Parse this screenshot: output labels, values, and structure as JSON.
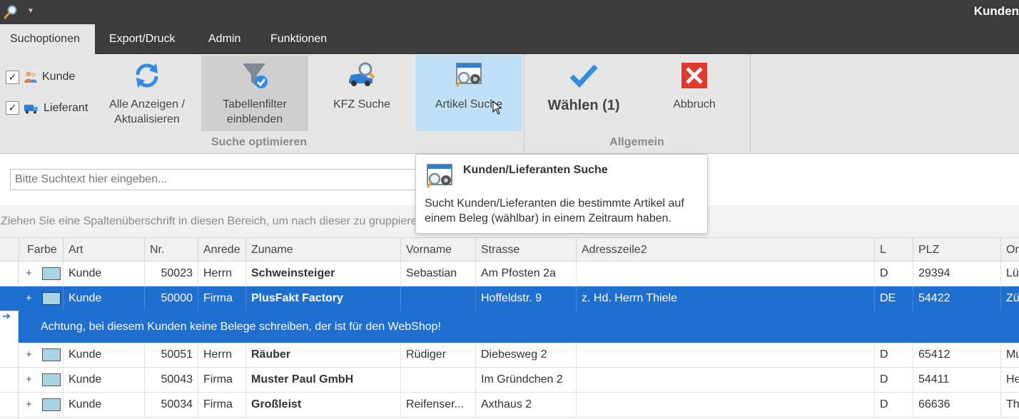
{
  "window": {
    "title": "Kunden",
    "app_icon": "magnifier-icon",
    "qat_icon": "chevron-down-icon"
  },
  "tabs": [
    {
      "label": "Suchoptionen",
      "active": true
    },
    {
      "label": "Export/Druck",
      "active": false
    },
    {
      "label": "Admin",
      "active": false
    },
    {
      "label": "Funktionen",
      "active": false
    }
  ],
  "ribbon": {
    "filters": [
      {
        "label": "Kunde",
        "checked": true,
        "icon": "customer-icon"
      },
      {
        "label": "Lieferant",
        "checked": true,
        "icon": "truck-icon"
      }
    ],
    "buttons": {
      "refresh": {
        "line1": "Alle Anzeigen /",
        "line2": "Aktualisieren",
        "icon": "refresh-icon"
      },
      "filter": {
        "line1": "Tabellenfilter",
        "line2": "einblenden",
        "icon": "funnel-check-icon"
      },
      "kfz": {
        "label": "KFZ Suche",
        "icon": "car-search-icon"
      },
      "artikel": {
        "label": "Artikel Suche",
        "icon": "article-search-icon"
      },
      "waehlen": {
        "label": "Wählen (1)",
        "icon": "checkmark-icon"
      },
      "abbruch": {
        "label": "Abbruch",
        "icon": "cancel-icon"
      }
    },
    "groups": {
      "search": "Suche optimieren",
      "general": "Allgemein"
    }
  },
  "search": {
    "placeholder": "Bitte Suchtext hier eingeben..."
  },
  "group_hint": "Ziehen Sie eine Spaltenüberschrift in diesen Bereich, um nach dieser zu gruppieren",
  "tooltip": {
    "title": "Kunden/Lieferanten Suche",
    "body": "Sucht Kunden/Lieferanten die bestimmte Artikel auf einem Beleg (wählbar) in einem Zeitraum haben."
  },
  "grid": {
    "columns": [
      "Farbe",
      "Art",
      "Nr.",
      "Anrede",
      "Zuname",
      "Vorname",
      "Strasse",
      "Adresszeile2",
      "L",
      "PLZ",
      "Ort"
    ],
    "rows": [
      {
        "art": "Kunde",
        "nr": "50023",
        "anrede": "Herrn",
        "zuname": "Schweinsteiger",
        "vorname": "Sebastian",
        "strasse": "Am Pfosten 2a",
        "adresszeile2": "",
        "land": "D",
        "plz": "29394",
        "ort": "Lüd",
        "selected": false
      },
      {
        "art": "Kunde",
        "nr": "50000",
        "anrede": "Firma",
        "zuname": "PlusFakt Factory",
        "vorname": "",
        "strasse": "Hoffeldstr. 9",
        "adresszeile2": "z. Hd. Herrn Thiele",
        "land": "DE",
        "plz": "54422",
        "ort": "Zü",
        "selected": true
      },
      {
        "art": "Kunde",
        "nr": "50051",
        "anrede": "Herrn",
        "zuname": "Räuber",
        "vorname": "Rüdiger",
        "strasse": "Diebesweg 2",
        "adresszeile2": "",
        "land": "D",
        "plz": "65412",
        "ort": "Mu",
        "selected": false
      },
      {
        "art": "Kunde",
        "nr": "50043",
        "anrede": "Firma",
        "zuname": "Muster Paul GmbH",
        "vorname": "",
        "strasse": "Im Gründchen 2",
        "adresszeile2": "",
        "land": "D",
        "plz": "54411",
        "ort": "He",
        "selected": false
      },
      {
        "art": "Kunde",
        "nr": "50034",
        "anrede": "Firma",
        "zuname": "Großleist",
        "vorname": "Reifenser...",
        "strasse": "Axthaus 2",
        "adresszeile2": "",
        "land": "D",
        "plz": "66636",
        "ort": "Th",
        "selected": false
      }
    ],
    "note": "Achtung, bei diesem Kunden keine Belege schreiben, der ist für den WebShop!",
    "swatch_color": "#a9d4e6"
  },
  "colors": {
    "selection": "#1f6fd1",
    "ribbon_bg": "#e6e6e6",
    "titlebar": "#3c3c3c",
    "hover": "#bfe0f7"
  }
}
